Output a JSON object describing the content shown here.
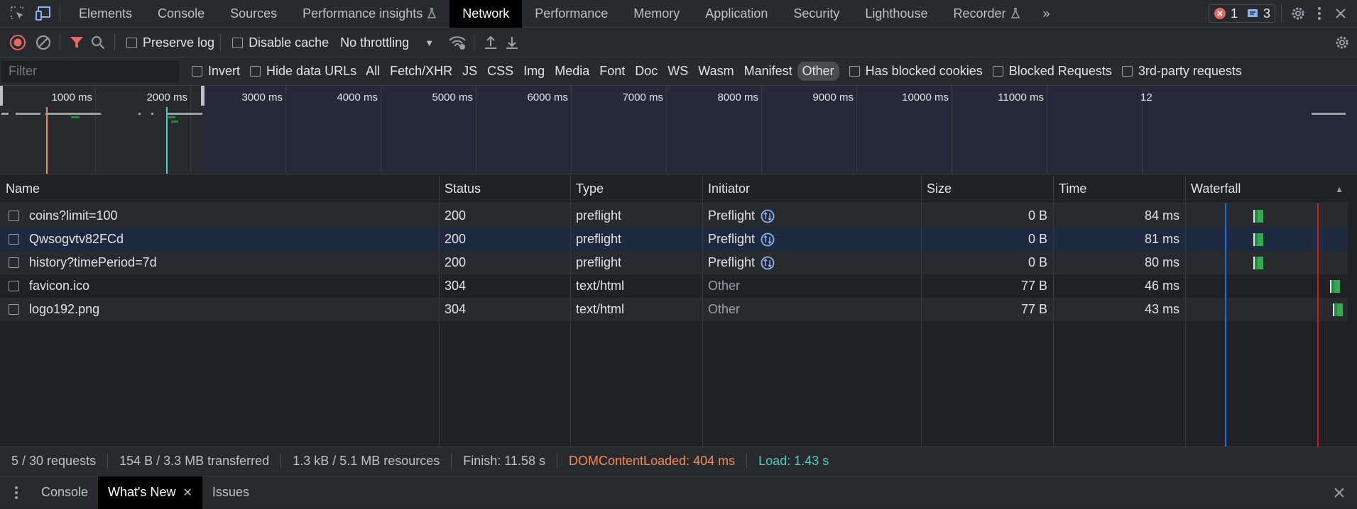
{
  "tabbar": {
    "tabs": [
      "Elements",
      "Console",
      "Sources",
      "Performance insights",
      "Network",
      "Performance",
      "Memory",
      "Application",
      "Security",
      "Lighthouse",
      "Recorder"
    ],
    "active": "Network",
    "errors_count": "1",
    "messages_count": "3",
    "more_label": "»"
  },
  "toolbar": {
    "preserve_log": "Preserve log",
    "disable_cache": "Disable cache",
    "throttling": "No throttling"
  },
  "filterbar": {
    "placeholder": "Filter",
    "invert": "Invert",
    "hide_data_urls": "Hide data URLs",
    "types": [
      "All",
      "Fetch/XHR",
      "JS",
      "CSS",
      "Img",
      "Media",
      "Font",
      "Doc",
      "WS",
      "Wasm",
      "Manifest",
      "Other"
    ],
    "active_type": "Other",
    "has_blocked_cookies": "Has blocked cookies",
    "blocked_requests": "Blocked Requests",
    "third_party": "3rd-party requests"
  },
  "overview": {
    "ticks": [
      "1000 ms",
      "2000 ms",
      "3000 ms",
      "4000 ms",
      "5000 ms",
      "6000 ms",
      "7000 ms",
      "8000 ms",
      "9000 ms",
      "10000 ms",
      "11000 ms",
      "12"
    ]
  },
  "table": {
    "columns": [
      "Name",
      "Status",
      "Type",
      "Initiator",
      "Size",
      "Time",
      "Waterfall"
    ],
    "rows": [
      {
        "name": "coins?limit=100",
        "status": "200",
        "type": "preflight",
        "initiator": "Preflight",
        "size": "0 B",
        "time": "84 ms",
        "wf": 0.42,
        "selected": false,
        "muted_init": false
      },
      {
        "name": "Qwsogvtv82FCd",
        "status": "200",
        "type": "preflight",
        "initiator": "Preflight",
        "size": "0 B",
        "time": "81 ms",
        "wf": 0.42,
        "selected": true,
        "muted_init": false
      },
      {
        "name": "history?timePeriod=7d",
        "status": "200",
        "type": "preflight",
        "initiator": "Preflight",
        "size": "0 B",
        "time": "80 ms",
        "wf": 0.42,
        "selected": false,
        "muted_init": false
      },
      {
        "name": "favicon.ico",
        "status": "304",
        "type": "text/html",
        "initiator": "Other",
        "size": "77 B",
        "time": "46 ms",
        "wf": 0.89,
        "selected": false,
        "muted_init": true
      },
      {
        "name": "logo192.png",
        "status": "304",
        "type": "text/html",
        "initiator": "Other",
        "size": "77 B",
        "time": "43 ms",
        "wf": 0.91,
        "selected": false,
        "muted_init": true
      }
    ]
  },
  "status": {
    "requests": "5 / 30 requests",
    "transferred": "154 B / 3.3 MB transferred",
    "resources": "1.3 kB / 5.1 MB resources",
    "finish": "Finish: 11.58 s",
    "dcl": "DOMContentLoaded: 404 ms",
    "load": "Load: 1.43 s",
    "dcl_color": "#f28b54",
    "load_color": "#4ecdc4"
  },
  "drawer": {
    "tabs": [
      "Console",
      "What's New",
      "Issues"
    ],
    "active": "What's New"
  }
}
